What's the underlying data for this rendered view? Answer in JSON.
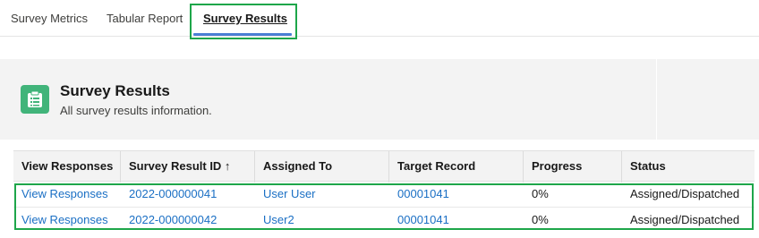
{
  "tabs": [
    {
      "label": "Survey Metrics"
    },
    {
      "label": "Tabular Report"
    },
    {
      "label": "Survey Results"
    }
  ],
  "header": {
    "icon": "clipboard-icon",
    "title": "Survey Results",
    "subtitle": "All survey results information."
  },
  "table": {
    "columns": [
      "View Responses",
      "Survey Result ID ↑",
      "Assigned To",
      "Target Record",
      "Progress",
      "Status"
    ],
    "rows": [
      {
        "view": "View Responses",
        "id": "2022-000000041",
        "assigned": "User User",
        "target": "00001041",
        "progress": "0%",
        "status": "Assigned/Dispatched"
      },
      {
        "view": "View Responses",
        "id": "2022-000000042",
        "assigned": "User2",
        "target": "00001041",
        "progress": "0%",
        "status": "Assigned/Dispatched"
      }
    ]
  },
  "colors": {
    "highlight": "#1ea64a",
    "link": "#1a6fc4",
    "icon_bg": "#41b47a",
    "tab_underline": "#4a7fd4"
  }
}
